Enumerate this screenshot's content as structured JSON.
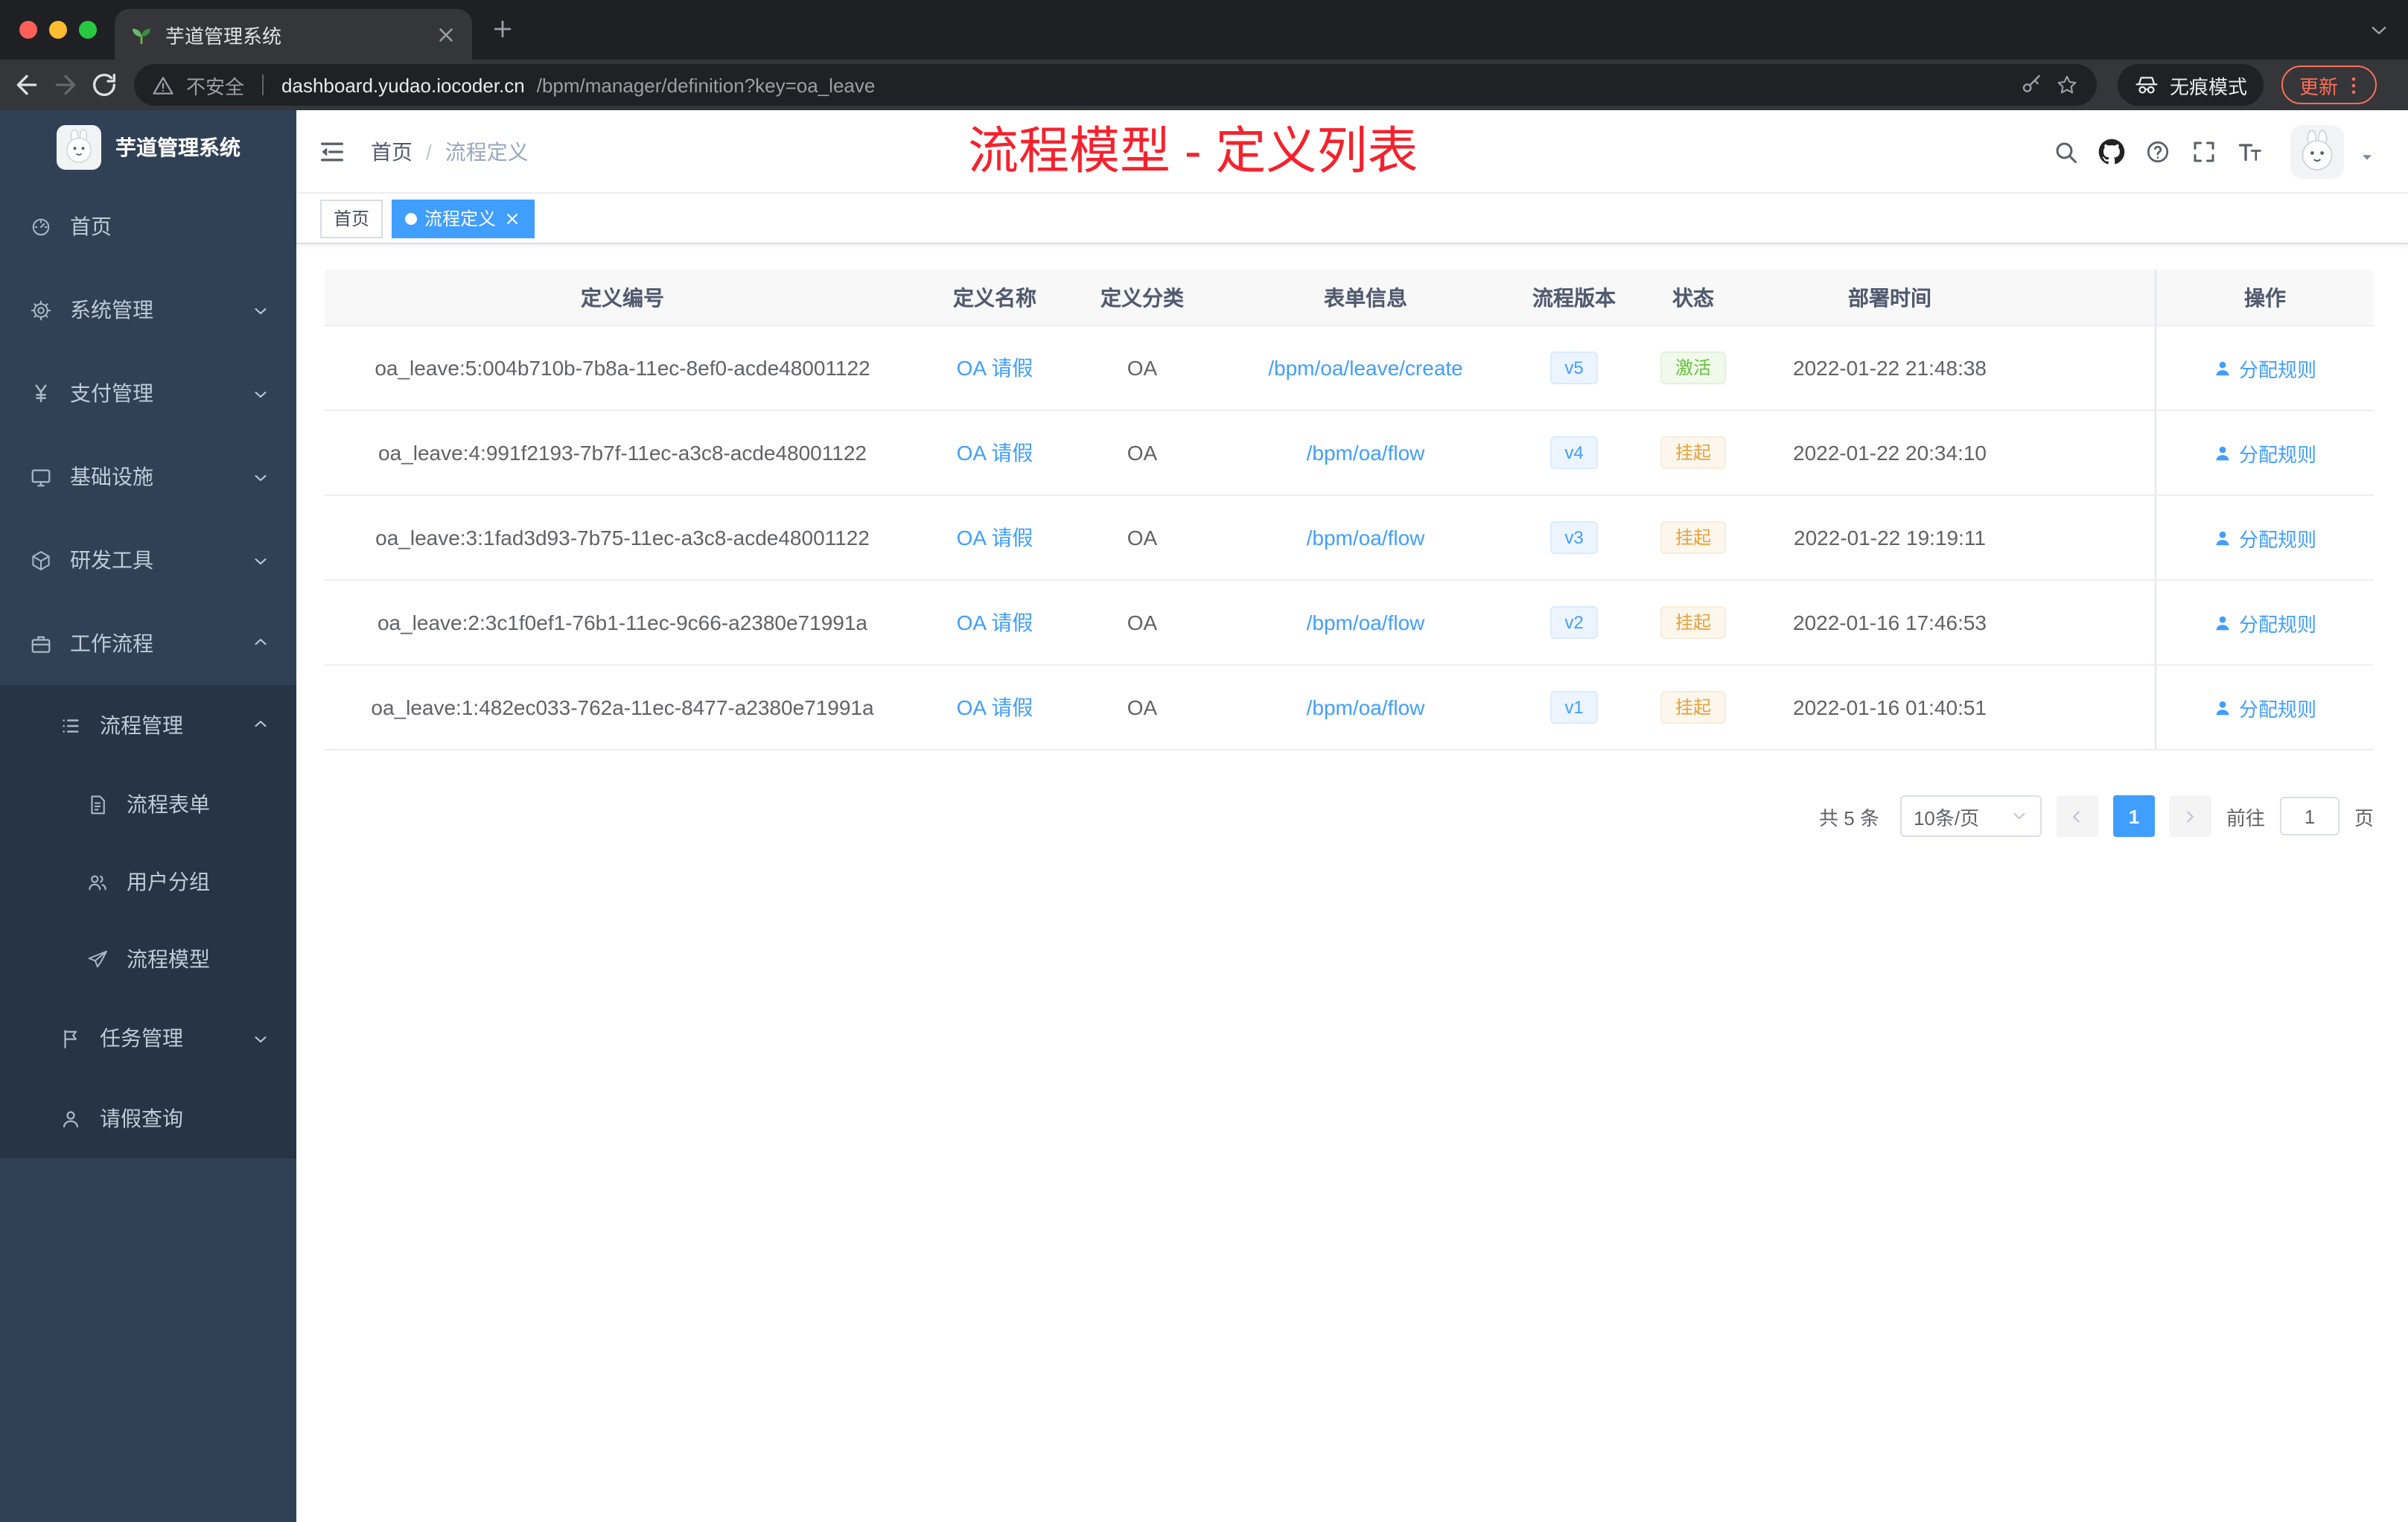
{
  "browser": {
    "tab": {
      "title": "芋道管理系统"
    },
    "toolbar": {
      "security_label": "不安全",
      "url_domain": "dashboard.yudao.iocoder.cn",
      "url_path": "/bpm/manager/definition?key=oa_leave",
      "incognito_label": "无痕模式",
      "update_label": "更新"
    }
  },
  "sidebar": {
    "logo_title": "芋道管理系统",
    "items": [
      {
        "label": "首页",
        "icon": "dashboard",
        "level": 1,
        "expandable": false,
        "expanded": false,
        "dark": false
      },
      {
        "label": "系统管理",
        "icon": "gear",
        "level": 1,
        "expandable": true,
        "expanded": false,
        "dark": false
      },
      {
        "label": "支付管理",
        "icon": "yen",
        "level": 1,
        "expandable": true,
        "expanded": false,
        "dark": false
      },
      {
        "label": "基础设施",
        "icon": "monitor",
        "level": 1,
        "expandable": true,
        "expanded": false,
        "dark": false
      },
      {
        "label": "研发工具",
        "icon": "cube",
        "level": 1,
        "expandable": true,
        "expanded": false,
        "dark": false
      },
      {
        "label": "工作流程",
        "icon": "briefcase",
        "level": 1,
        "expandable": true,
        "expanded": true,
        "dark": false
      },
      {
        "label": "流程管理",
        "icon": "listmenu",
        "level": 2,
        "expandable": true,
        "expanded": true,
        "dark": true
      },
      {
        "label": "流程表单",
        "icon": "doc",
        "level": 3,
        "expandable": false,
        "expanded": false,
        "dark": true
      },
      {
        "label": "用户分组",
        "icon": "users",
        "level": 3,
        "expandable": false,
        "expanded": false,
        "dark": true
      },
      {
        "label": "流程模型",
        "icon": "send",
        "level": 3,
        "expandable": false,
        "expanded": false,
        "dark": true
      },
      {
        "label": "任务管理",
        "icon": "flag",
        "level": 2,
        "expandable": true,
        "expanded": false,
        "dark": true
      },
      {
        "label": "请假查询",
        "icon": "person",
        "level": 2,
        "expandable": false,
        "expanded": false,
        "dark": true
      }
    ]
  },
  "navbar": {
    "breadcrumb": [
      "首页",
      "流程定义"
    ],
    "separator": "/",
    "annotation": "流程模型 - 定义列表"
  },
  "tags": [
    {
      "label": "首页",
      "active": false,
      "closable": false
    },
    {
      "label": "流程定义",
      "active": true,
      "closable": true
    }
  ],
  "table": {
    "columns": [
      "定义编号",
      "定义名称",
      "定义分类",
      "表单信息",
      "流程版本",
      "状态",
      "部署时间",
      "操作"
    ],
    "rows": [
      {
        "id": "oa_leave:5:004b710b-7b8a-11ec-8ef0-acde48001122",
        "name": "OA 请假",
        "category": "OA",
        "form": "/bpm/oa/leave/create",
        "version": "v5",
        "status": "激活",
        "status_type": "success",
        "deploy_time": "2022-01-22 21:48:38",
        "action": "分配规则"
      },
      {
        "id": "oa_leave:4:991f2193-7b7f-11ec-a3c8-acde48001122",
        "name": "OA 请假",
        "category": "OA",
        "form": "/bpm/oa/flow",
        "version": "v4",
        "status": "挂起",
        "status_type": "warning",
        "deploy_time": "2022-01-22 20:34:10",
        "action": "分配规则"
      },
      {
        "id": "oa_leave:3:1fad3d93-7b75-11ec-a3c8-acde48001122",
        "name": "OA 请假",
        "category": "OA",
        "form": "/bpm/oa/flow",
        "version": "v3",
        "status": "挂起",
        "status_type": "warning",
        "deploy_time": "2022-01-22 19:19:11",
        "action": "分配规则"
      },
      {
        "id": "oa_leave:2:3c1f0ef1-76b1-11ec-9c66-a2380e71991a",
        "name": "OA 请假",
        "category": "OA",
        "form": "/bpm/oa/flow",
        "version": "v2",
        "status": "挂起",
        "status_type": "warning",
        "deploy_time": "2022-01-16 17:46:53",
        "action": "分配规则"
      },
      {
        "id": "oa_leave:1:482ec033-762a-11ec-8477-a2380e71991a",
        "name": "OA 请假",
        "category": "OA",
        "form": "/bpm/oa/flow",
        "version": "v1",
        "status": "挂起",
        "status_type": "warning",
        "deploy_time": "2022-01-16 01:40:51",
        "action": "分配规则"
      }
    ]
  },
  "pagination": {
    "total_label": "共 5 条",
    "page_size": "10条/页",
    "current_page": "1",
    "goto_label": "前往",
    "goto_value": "1",
    "page_unit": "页"
  },
  "colors": {
    "accent": "#409eff",
    "annotation_red": "#f5222d",
    "success_text": "#67c23a",
    "warning_text": "#e6a23c",
    "sidebar_bg": "#304156",
    "submenu_bg": "#263445",
    "update_badge": "#ff6e56"
  }
}
